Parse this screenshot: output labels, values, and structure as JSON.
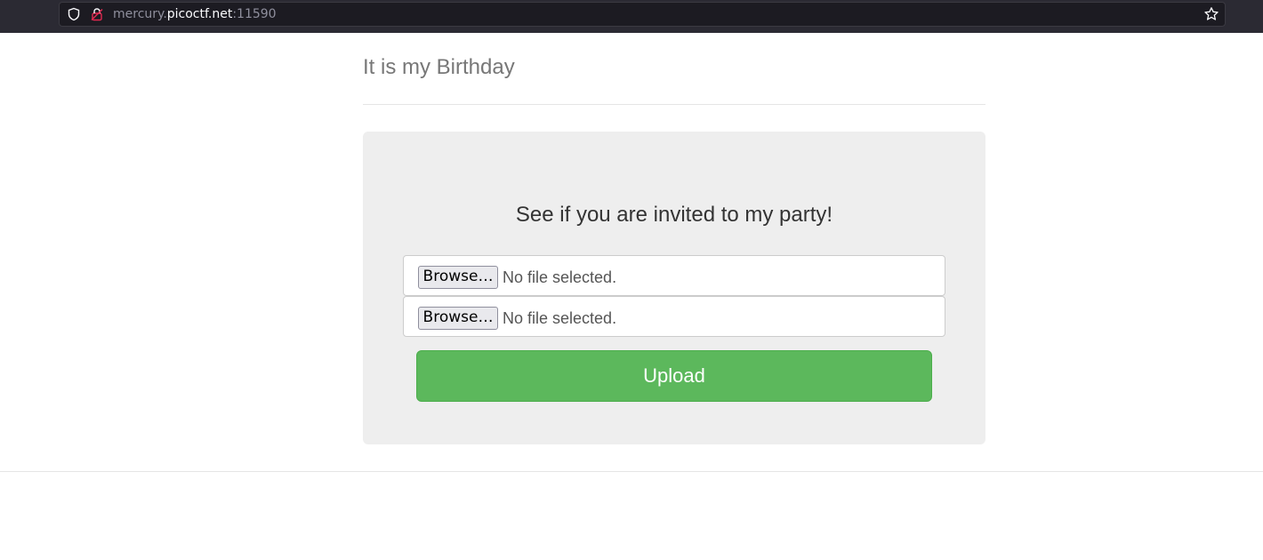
{
  "browser": {
    "url_prefix": "mercury.",
    "url_host": "picoctf.net",
    "url_suffix": ":11590"
  },
  "header": {
    "title": "It is my Birthday"
  },
  "form": {
    "heading": "See if you are invited to my party!",
    "file_inputs": [
      {
        "button_label": "Browse…",
        "status": "No file selected."
      },
      {
        "button_label": "Browse…",
        "status": "No file selected."
      }
    ],
    "submit_label": "Upload"
  },
  "colors": {
    "upload_button": "#5cb85c",
    "jumbotron_bg": "#eeeeee"
  }
}
